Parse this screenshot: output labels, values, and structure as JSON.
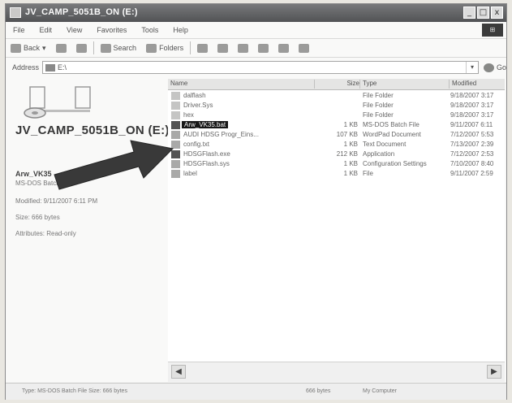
{
  "window": {
    "title": "JV_CAMP_5051B_ON (E:)",
    "controls": [
      "_",
      "□",
      "x"
    ]
  },
  "menu": [
    "File",
    "Edit",
    "View",
    "Favorites",
    "Tools",
    "Help"
  ],
  "toolbar": {
    "back": "Back",
    "search": "Search",
    "folders": "Folders"
  },
  "address": {
    "label": "Address",
    "value": "E:\\",
    "go": "Go"
  },
  "left_panel": {
    "drive_label": "JV_CAMP_5051B_ON (E:)",
    "selected_name": "Arw_VK35",
    "selected_type": "MS-DOS Batch File",
    "modified": "Modified: 9/11/2007 6:11 PM",
    "size": "Size: 666 bytes",
    "attributes": "Attributes: Read-only"
  },
  "columns": [
    "Name",
    "Size",
    "Type",
    "Modified"
  ],
  "files": [
    {
      "name": "dalflash",
      "size": "",
      "type": "File Folder",
      "modified": "9/18/2007 3:17",
      "icon": "folder-icon"
    },
    {
      "name": "Driver.Sys",
      "size": "",
      "type": "File Folder",
      "modified": "9/18/2007 3:17",
      "icon": "folder-icon"
    },
    {
      "name": "hex",
      "size": "",
      "type": "File Folder",
      "modified": "9/18/2007 3:17",
      "icon": "folder-icon"
    },
    {
      "name": "Arw_VK35.bat",
      "size": "1 KB",
      "type": "MS-DOS Batch File",
      "modified": "9/11/2007 6:11",
      "icon": "batch-file-icon",
      "selected": true
    },
    {
      "name": "AUDI HDSG Progr_Eins...",
      "size": "107 KB",
      "type": "WordPad Document",
      "modified": "7/12/2007 5:53",
      "icon": "document-icon"
    },
    {
      "name": "config.txt",
      "size": "1 KB",
      "type": "Text Document",
      "modified": "7/13/2007 2:39",
      "icon": "text-file-icon"
    },
    {
      "name": "HDSGFlash.exe",
      "size": "212 KB",
      "type": "Application",
      "modified": "7/12/2007 2:53",
      "icon": "application-icon"
    },
    {
      "name": "HDSGFlash.sys",
      "size": "1 KB",
      "type": "Configuration Settings",
      "modified": "7/10/2007 8:40",
      "icon": "settings-file-icon"
    },
    {
      "name": "label",
      "size": "1 KB",
      "type": "File",
      "modified": "9/11/2007 2:59",
      "icon": "file-icon"
    }
  ],
  "status": {
    "left": "Type: MS-DOS Batch File Size: 666 bytes",
    "middle": "666 bytes",
    "right": "My Computer"
  }
}
